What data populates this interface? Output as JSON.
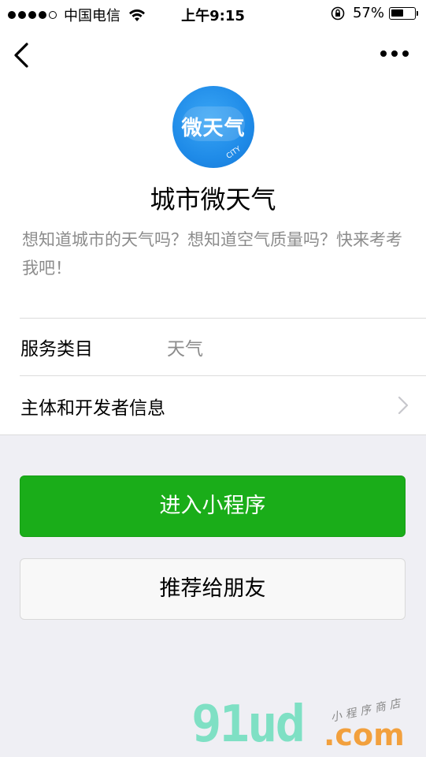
{
  "status_bar": {
    "carrier": "中国电信",
    "time": "上午9:15",
    "battery_percent": "57%",
    "battery_level": 0.57,
    "signal_bars": 4,
    "signal_total": 5
  },
  "nav": {
    "back_icon": "chevron-left-icon",
    "more_icon": "more-dots-icon"
  },
  "app": {
    "icon_text": "微天气",
    "icon_subtext": "CITY",
    "name": "城市微天气",
    "description": "想知道城市的天气吗？想知道空气质量吗？快来考考我吧！",
    "icon_color": "#1f8be8"
  },
  "info_rows": {
    "category_label": "服务类目",
    "category_value": "天气",
    "developer_label": "主体和开发者信息"
  },
  "buttons": {
    "enter_label": "进入小程序",
    "recommend_label": "推荐给朋友",
    "primary_color": "#1aad19"
  },
  "watermark": {
    "brand": "91ud",
    "domain": ".com",
    "tagline": "小程序商店"
  }
}
